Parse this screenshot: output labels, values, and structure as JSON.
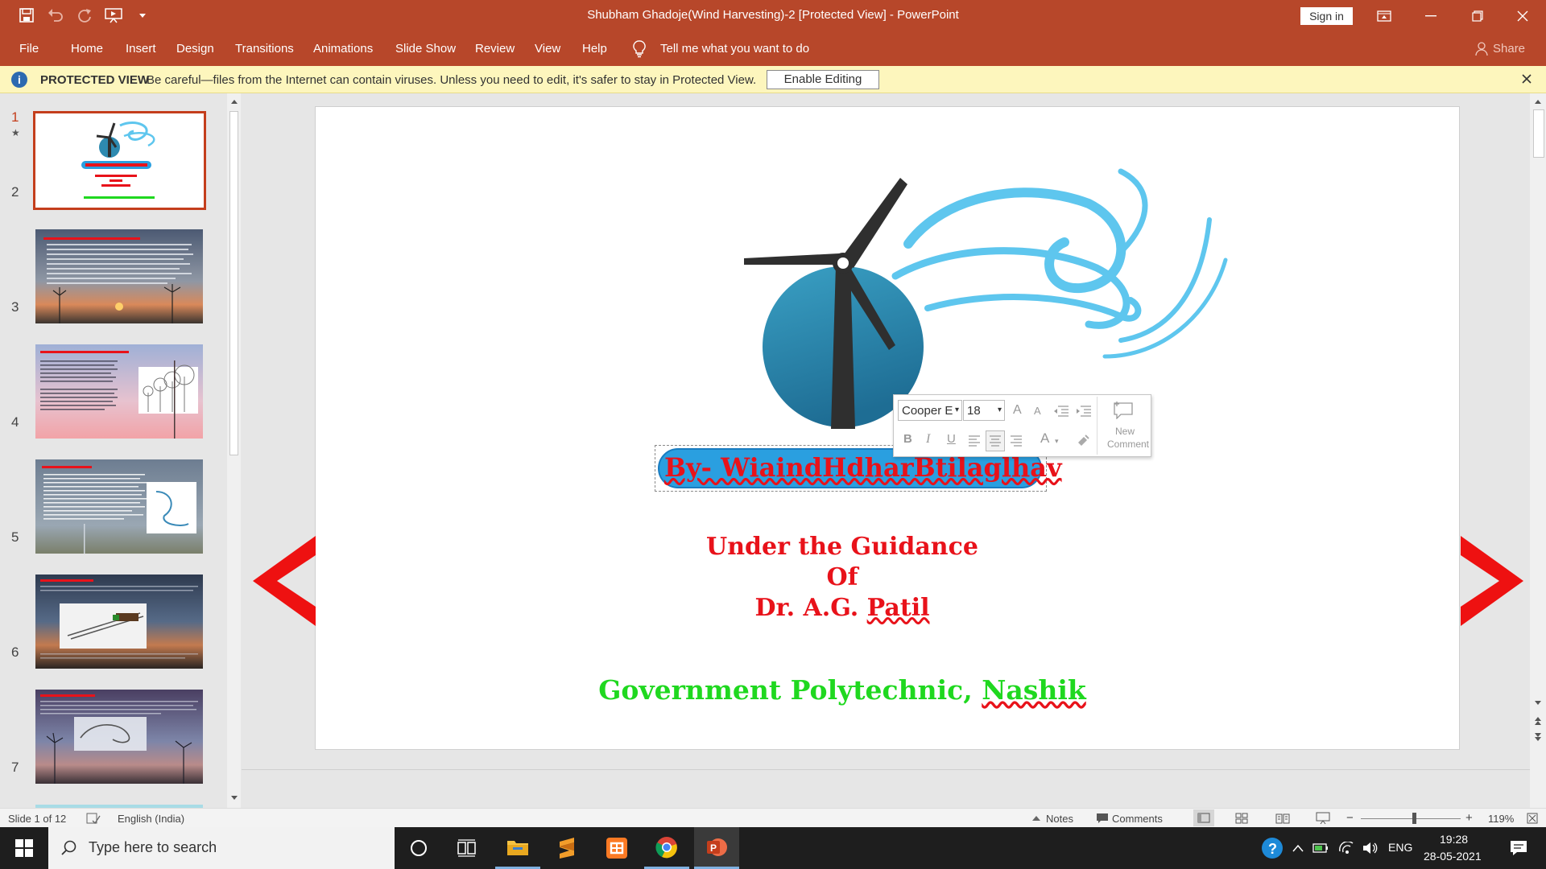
{
  "window": {
    "title": "Shubham Ghadoje(Wind Harvesting)-2 [Protected View]  -  PowerPoint",
    "sign_in": "Sign in"
  },
  "ribbon": {
    "tabs": [
      "File",
      "Home",
      "Insert",
      "Design",
      "Transitions",
      "Animations",
      "Slide Show",
      "Review",
      "View",
      "Help"
    ],
    "tell_me": "Tell me what you want to do",
    "share": "Share"
  },
  "protected_view": {
    "label": "PROTECTED VIEW",
    "message": "Be careful—files from the Internet can contain viruses. Unless you need to edit, it's safer to stay in Protected View.",
    "enable_button": "Enable Editing"
  },
  "thumbnails": {
    "numbers": [
      "1",
      "2",
      "3",
      "4",
      "5",
      "6",
      "7"
    ],
    "slide1": {
      "title": "By- Wind Harvesting",
      "l1": "Under the Guidance",
      "l2": "Of",
      "l3": "Dr. A.G. Patil",
      "l4": "Government Polytechnic, Nashik"
    },
    "slide2_title": "Introduction to wind technology",
    "slide3_title": "Reasons behind the development of wind energy",
    "slide4_title": "Wind energy history",
    "slide5_title": "Wind turbine technology",
    "slide6_title": "Working of a wind turbine"
  },
  "slide": {
    "by_line": "By- WiaindHdharBtilaglhav",
    "guidance1": "Under the Guidance",
    "guidance2": "Of",
    "guidance3_prefix": "Dr. A.G. ",
    "guidance3_name": "Patil",
    "institute_prefix": "Government Polytechnic, ",
    "institute_city": "Nashik",
    "colors": {
      "red": "#e8121a",
      "green": "#1fd81f",
      "pill": "#2a9fe0",
      "orb": "#2d8ab0",
      "wind": "#5ec6ee",
      "blade": "#2f2f2f"
    }
  },
  "mini_toolbar": {
    "font": "Cooper E",
    "size": "18",
    "grow_font": "A",
    "shrink_font": "A",
    "bold": "B",
    "italic": "I",
    "underline": "U",
    "font_color": "A",
    "new_comment_1": "New",
    "new_comment_2": "Comment"
  },
  "status": {
    "slide_of": "Slide 1 of 12",
    "language": "English (India)",
    "notes": "Notes",
    "comments": "Comments",
    "zoom": "119%",
    "zoom_minus": "−",
    "zoom_plus": "+"
  },
  "taskbar": {
    "search_placeholder": "Type here to search",
    "lang": "ENG",
    "time": "19:28",
    "date": "28-05-2021"
  },
  "icons": {
    "save": "save-icon",
    "undo": "undo-icon",
    "redo": "redo-icon",
    "present": "present-from-beginning-icon",
    "customize": "customize-qat-icon",
    "lightbulb": "lightbulb-icon",
    "info": "info-icon",
    "windows": "windows-start-icon",
    "search": "search-icon"
  }
}
